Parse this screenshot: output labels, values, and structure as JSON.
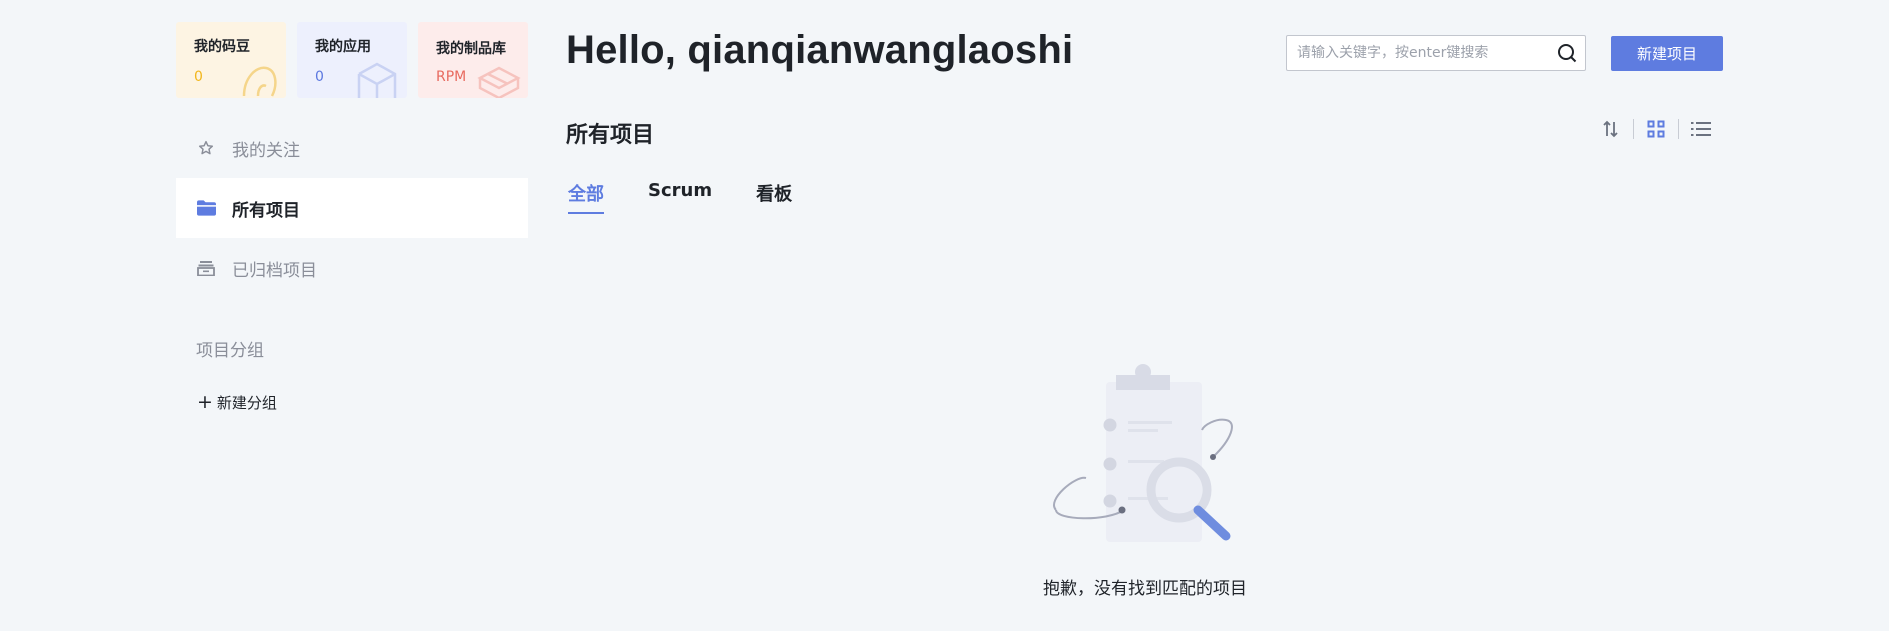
{
  "cards": [
    {
      "title": "我的码豆",
      "value": "0",
      "icon": "coin-deco-icon"
    },
    {
      "title": "我的应用",
      "value": "0",
      "icon": "cube-deco-icon"
    },
    {
      "title": "我的制品库",
      "value": "RPM",
      "icon": "package-deco-icon"
    }
  ],
  "nav": [
    {
      "label": "我的关注",
      "icon": "star-icon"
    },
    {
      "label": "所有项目",
      "icon": "folder-icon",
      "active": true
    },
    {
      "label": "已归档项目",
      "icon": "archive-icon"
    }
  ],
  "groups": {
    "title": "项目分组",
    "new_label": "新建分组"
  },
  "header": {
    "greeting": "Hello, qianqianwanglaoshi",
    "search_placeholder": "请输入关键字，按enter键搜索",
    "new_project_label": "新建项目"
  },
  "main": {
    "section_title": "所有项目",
    "tabs": [
      {
        "label": "全部",
        "active": true
      },
      {
        "label": "Scrum"
      },
      {
        "label": "看板"
      }
    ],
    "view_tools": [
      "sort-icon",
      "grid-view-icon",
      "list-view-icon"
    ],
    "empty_text": "抱歉，没有找到匹配的项目"
  },
  "colors": {
    "accent": "#5e7ce0",
    "background": "#f3f6f9",
    "coin": "#f2b61b",
    "rpm": "#e86a5f"
  }
}
